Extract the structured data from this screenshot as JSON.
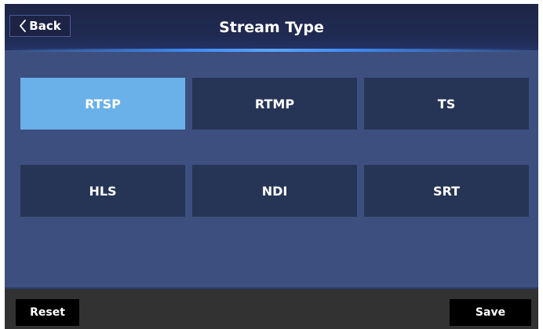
{
  "header": {
    "back_label": "Back",
    "title": "Stream Type"
  },
  "options": [
    {
      "label": "RTSP",
      "selected": true
    },
    {
      "label": "RTMP",
      "selected": false
    },
    {
      "label": "TS",
      "selected": false
    },
    {
      "label": "HLS",
      "selected": false
    },
    {
      "label": "NDI",
      "selected": false
    },
    {
      "label": "SRT",
      "selected": false
    }
  ],
  "footer": {
    "reset_label": "Reset",
    "save_label": "Save"
  },
  "colors": {
    "background": "#3d4f7e",
    "header": "#1e2547",
    "button": "#263556",
    "selected": "#6ab1ea",
    "footer": "#323232",
    "footer_button": "#000000"
  },
  "icons": {
    "back": "chevron-left-icon"
  }
}
